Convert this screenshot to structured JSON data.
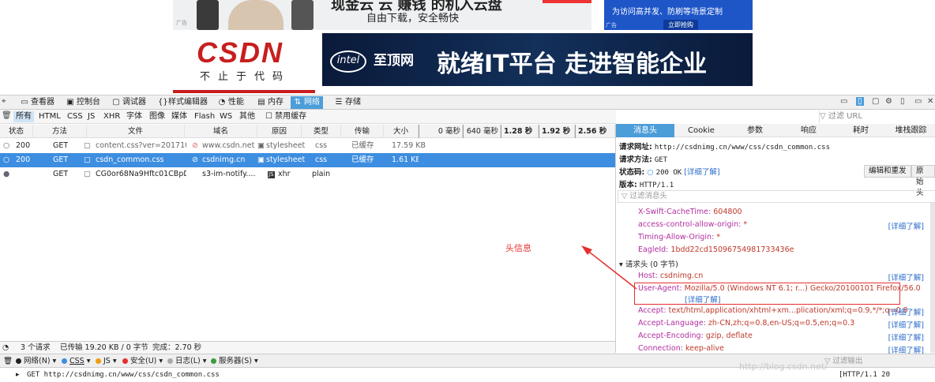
{
  "page": {
    "ad1": {
      "line1": "现金云 云 赚钱 的机入云盘",
      "line2": "自由下载，安全畅快",
      "tag": "广告"
    },
    "ad2": {
      "text": "为访问高并发、防刷等场景定制",
      "button": "立即抢购",
      "tag": "广告"
    },
    "logo": {
      "word": "CSDN",
      "slogan": "不止于代码"
    },
    "ad3": {
      "intel": "intel",
      "brand": "至顶网",
      "headline": "就绪IT平台 走进智能企业"
    }
  },
  "devtools": {
    "tabs": [
      {
        "label": "查看器",
        "icon": "inspector-icon"
      },
      {
        "label": "控制台",
        "icon": "console-icon"
      },
      {
        "label": "调试器",
        "icon": "debugger-icon"
      },
      {
        "label": "样式编辑器",
        "icon": "style-editor-icon"
      },
      {
        "label": "性能",
        "icon": "performance-icon"
      },
      {
        "label": "内存",
        "icon": "memory-icon"
      },
      {
        "label": "网络",
        "icon": "network-icon"
      },
      {
        "label": "存储",
        "icon": "storage-icon"
      }
    ],
    "filters": [
      "所有",
      "HTML",
      "CSS",
      "JS",
      "XHR",
      "字体",
      "图像",
      "媒体",
      "Flash",
      "WS",
      "其他"
    ],
    "disable_cache": "禁用缓存",
    "url_filter_placeholder": "过滤 URL",
    "columns": [
      "状态",
      "方法",
      "文件",
      "域名",
      "原因",
      "类型",
      "传输",
      "大小"
    ],
    "timeline": [
      "0 毫秒",
      "640 毫秒",
      "1.28 秒",
      "1.92 秒",
      "2.56 秒"
    ],
    "requests": [
      {
        "status": "200",
        "method": "GET",
        "file": "content.css?ver=20171020",
        "domain": "www.csdn.net",
        "cause": "stylesheet",
        "type": "css",
        "transferred": "已缓存",
        "size": "17.59 KB"
      },
      {
        "status": "200",
        "method": "GET",
        "file": "csdn_common.css",
        "domain": "csdnimg.cn",
        "cause": "stylesheet",
        "type": "css",
        "transferred": "已缓存",
        "size": "1.61 KB"
      },
      {
        "status": "",
        "method": "GET",
        "file": "CG0or68Na9Hftc01CBpD...",
        "domain": "s3-im-notify....",
        "cause": "xhr",
        "type": "plain",
        "transferred": "",
        "size": ""
      }
    ],
    "summary": {
      "requests": "3 个请求",
      "transferred": "已传输 19.20 KB / 0 字节",
      "finish": "完成：2.70 秒"
    },
    "detail": {
      "tabs": [
        "消息头",
        "Cookie",
        "参数",
        "响应",
        "耗时",
        "堆栈跟踪"
      ],
      "request_url_label": "请求网址:",
      "request_url": "http://csdnimg.cn/www/css/csdn_common.css",
      "method_label": "请求方法:",
      "method": "GET",
      "status_label": "状态码:",
      "status": "200 OK",
      "learn_more": "[详细了解]",
      "version_label": "版本:",
      "version": "HTTP/1.1",
      "edit_resend": "编辑和重发",
      "raw_headers": "原始头",
      "filter_headers_placeholder": "过滤消息头",
      "response_headers": [
        {
          "name": "X-Swift-CacheTime:",
          "value": "604800",
          "more": ""
        },
        {
          "name": "access-control-allow-origin:",
          "value": "*",
          "more": "[详细了解]"
        },
        {
          "name": "Timing-Allow-Origin:",
          "value": "*",
          "more": ""
        },
        {
          "name": "EagleId:",
          "value": "1bdd22cd15096754981733436e",
          "more": ""
        }
      ],
      "request_headers_title": "请求头 (0 字节)",
      "request_headers": [
        {
          "name": "Host:",
          "value": "csdnimg.cn",
          "more": "[详细了解]"
        },
        {
          "name": "User-Agent:",
          "value": "Mozilla/5.0 (Windows NT 6.1; r...) Gecko/20100101 Firefox/56.0",
          "more": "[详细了解]"
        },
        {
          "name": "Accept:",
          "value": "text/html,application/xhtml+xm...plication/xml;q=0.9,*/*;q=0.8",
          "more": "[详细了解]"
        },
        {
          "name": "Accept-Language:",
          "value": "zh-CN,zh;q=0.8,en-US;q=0.5,en;q=0.3",
          "more": "[详细了解]"
        },
        {
          "name": "Accept-Encoding:",
          "value": "gzip, deflate",
          "more": "[详细了解]"
        },
        {
          "name": "Connection:",
          "value": "keep-alive",
          "more": "[详细了解]"
        }
      ]
    },
    "console_filters": [
      "网络(N)",
      "CSS",
      "JS",
      "安全(U)",
      "日志(L)",
      "服务器(S)"
    ],
    "console_filter_placeholder": "过滤输出",
    "console_line": "GET http://csdnimg.cn/www/css/csdn_common.css",
    "console_line_right": "[HTTP/1.1 20"
  },
  "annotation": "头信息",
  "watermark": "http://blog.csdn.net/"
}
